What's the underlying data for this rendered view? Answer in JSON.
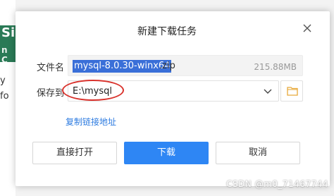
{
  "background": {
    "partial_title": "Si",
    "partial_subtitle": "n C",
    "partial_text": "y\nfo"
  },
  "dialog": {
    "title": "新建下载任务",
    "filename_label": "文件名",
    "filename_selected": "mysql-8.0.30-winx64",
    "filename_ext": ".zip",
    "filesize": "215.88MB",
    "save_label": "保存到",
    "save_path": "E:\\mysql",
    "copy_link": "复制链接地址",
    "buttons": {
      "open": "直接打开",
      "download": "下载",
      "cancel": "取消"
    }
  },
  "watermark": "CSDN @m0_71467744",
  "colors": {
    "accent": "#2e86f4",
    "selection": "#3a6fd8",
    "annotation": "#d9322c",
    "folder_icon": "#e8a93a"
  },
  "icons": {
    "close": "close-icon",
    "dropdown": "chevron-down-icon",
    "folder": "folder-icon"
  }
}
